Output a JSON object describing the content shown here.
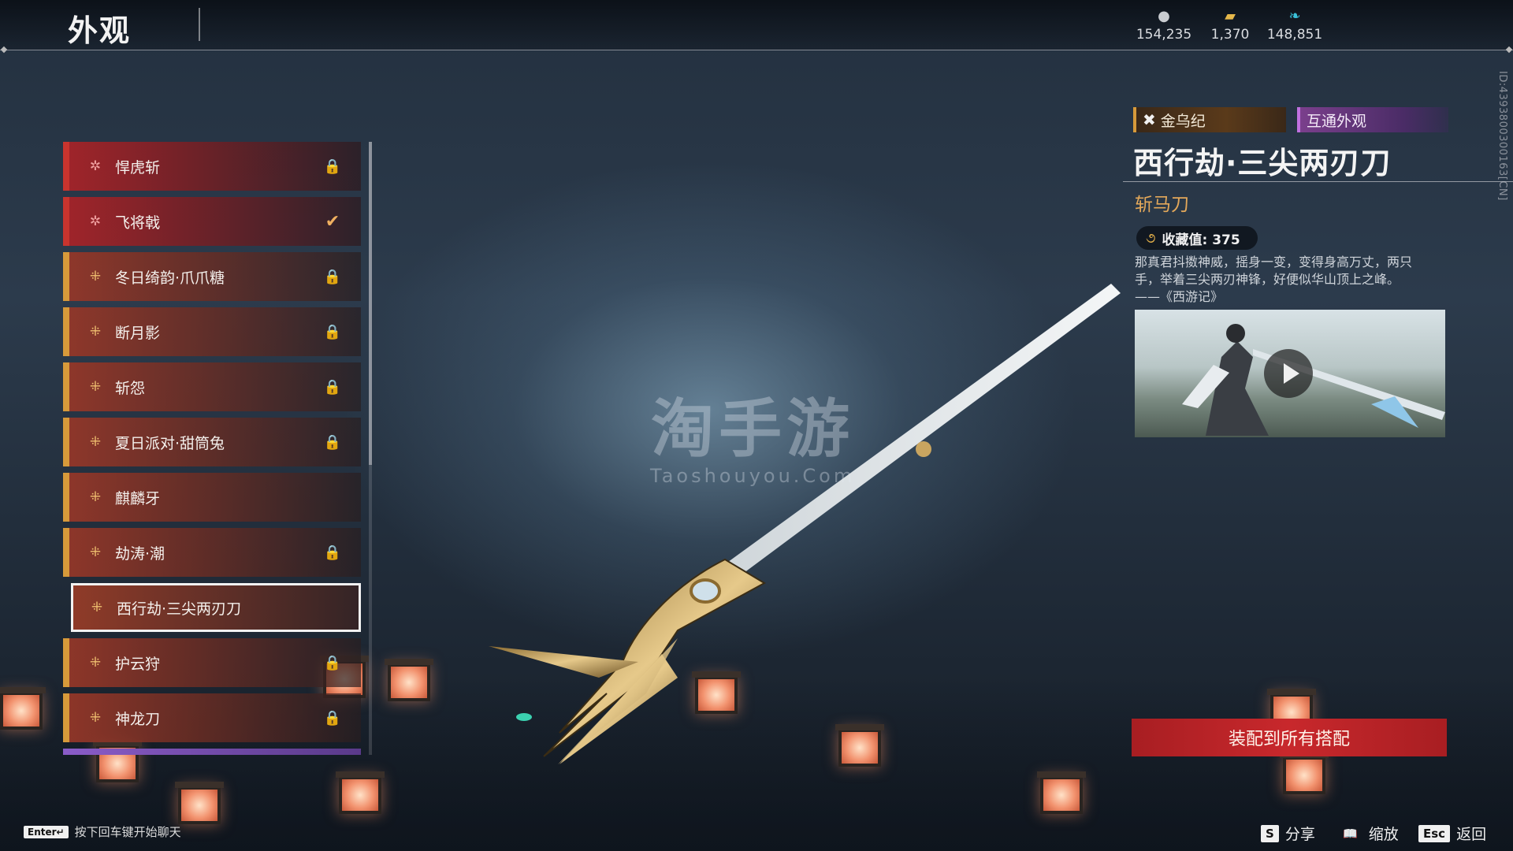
{
  "header": {
    "title": "外观"
  },
  "currencies": [
    {
      "icon": "silver-coin-icon",
      "value": "154,235"
    },
    {
      "icon": "gold-ingot-icon",
      "value": "1,370"
    },
    {
      "icon": "jade-feather-icon",
      "value": "148,851"
    }
  ],
  "vertical_id": "ID:4393800300163[CN]",
  "skin_list": {
    "items": [
      {
        "label": "悍虎斩",
        "icon": "star-icon",
        "status": "locked"
      },
      {
        "label": "飞将戟",
        "icon": "star-icon",
        "status": "equipped"
      },
      {
        "label": "冬日绮韵·爪爪糖",
        "icon": "cross-emblem-icon",
        "status": "locked"
      },
      {
        "label": "断月影",
        "icon": "cross-emblem-icon",
        "status": "locked"
      },
      {
        "label": "斩怨",
        "icon": "cross-emblem-icon",
        "status": "locked"
      },
      {
        "label": "夏日派对·甜筒兔",
        "icon": "cross-emblem-icon",
        "status": "locked"
      },
      {
        "label": "麒麟牙",
        "icon": "cross-emblem-icon",
        "status": ""
      },
      {
        "label": "劫涛·潮",
        "icon": "cross-emblem-icon",
        "status": "locked"
      },
      {
        "label": "西行劫·三尖两刃刀",
        "icon": "cross-emblem-icon",
        "status": "selected"
      },
      {
        "label": "护云狩",
        "icon": "cross-emblem-icon",
        "status": "locked"
      },
      {
        "label": "神龙刀",
        "icon": "cross-emblem-icon",
        "status": "locked"
      }
    ],
    "lock_glyph": "🔒",
    "check_glyph": "✔",
    "star_glyph": "✲",
    "cross_glyph": "⁜"
  },
  "watermark": {
    "cn": "淘手游",
    "en": "Taoshouyou.Com"
  },
  "detail": {
    "series_tag": "金乌纪",
    "series_icon": "✖",
    "shared_tag": "互通外观",
    "name": "西行劫·三尖两刃刀",
    "type": "斩马刀",
    "collect_icon": "૭",
    "collect_label": "收藏值: 375",
    "description_lines": [
      "那真君抖擞神威，摇身一变，变得身高万丈，两只",
      "手，举着三尖两刃神锋，好便似华山顶上之峰。",
      "——《西游记》"
    ],
    "equip_all_label": "装配到所有搭配"
  },
  "bottom": {
    "chat_key": "Enter↵",
    "chat_hint": "按下回车键开始聊天",
    "hints": [
      {
        "key": "S",
        "label": "分享"
      },
      {
        "key": "📖",
        "label": "缩放"
      },
      {
        "key": "Esc",
        "label": "返回"
      }
    ]
  },
  "colors": {
    "equip_button": "#c8282c",
    "type_text": "#e3a85a",
    "shared_tag": "#7a3f8c"
  }
}
